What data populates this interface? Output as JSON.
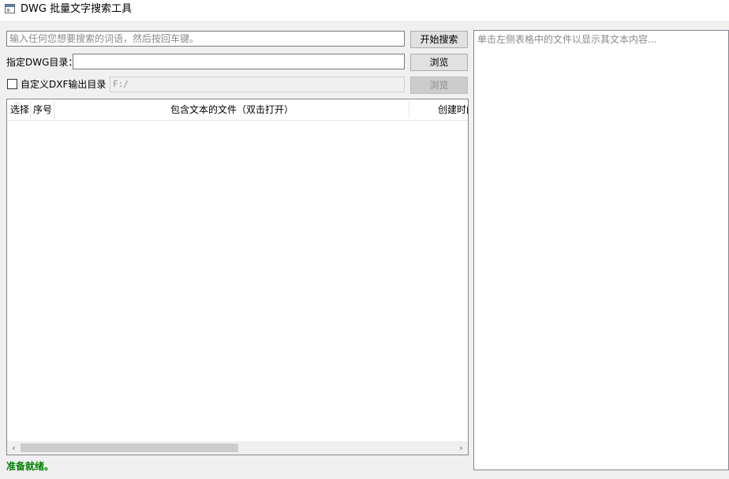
{
  "window": {
    "title": "DWG 批量文字搜索工具",
    "icon": "app-window-icon"
  },
  "search": {
    "placeholder": "输入任何您想要搜索的词语，然后按回车键。",
    "value": "",
    "button_label": "开始搜索"
  },
  "dwg_dir": {
    "label": "指定DWG目录：",
    "value": "",
    "browse_label": "浏览"
  },
  "dxf_output": {
    "checkbox_label": "自定义DXF输出目录",
    "checked": false,
    "path": "F:/",
    "browse_label": "浏览",
    "enabled": false
  },
  "table": {
    "columns": [
      "选择",
      "序号",
      "包含文本的文件（双击打开）",
      "创建时间"
    ],
    "rows": [],
    "scroll_left_icon": "chevron-left-icon",
    "scroll_right_icon": "chevron-right-icon"
  },
  "preview": {
    "placeholder": "单击左侧表格中的文件以显示其文本内容..."
  },
  "status": {
    "text": "准备就绪。",
    "color": "#008000"
  }
}
